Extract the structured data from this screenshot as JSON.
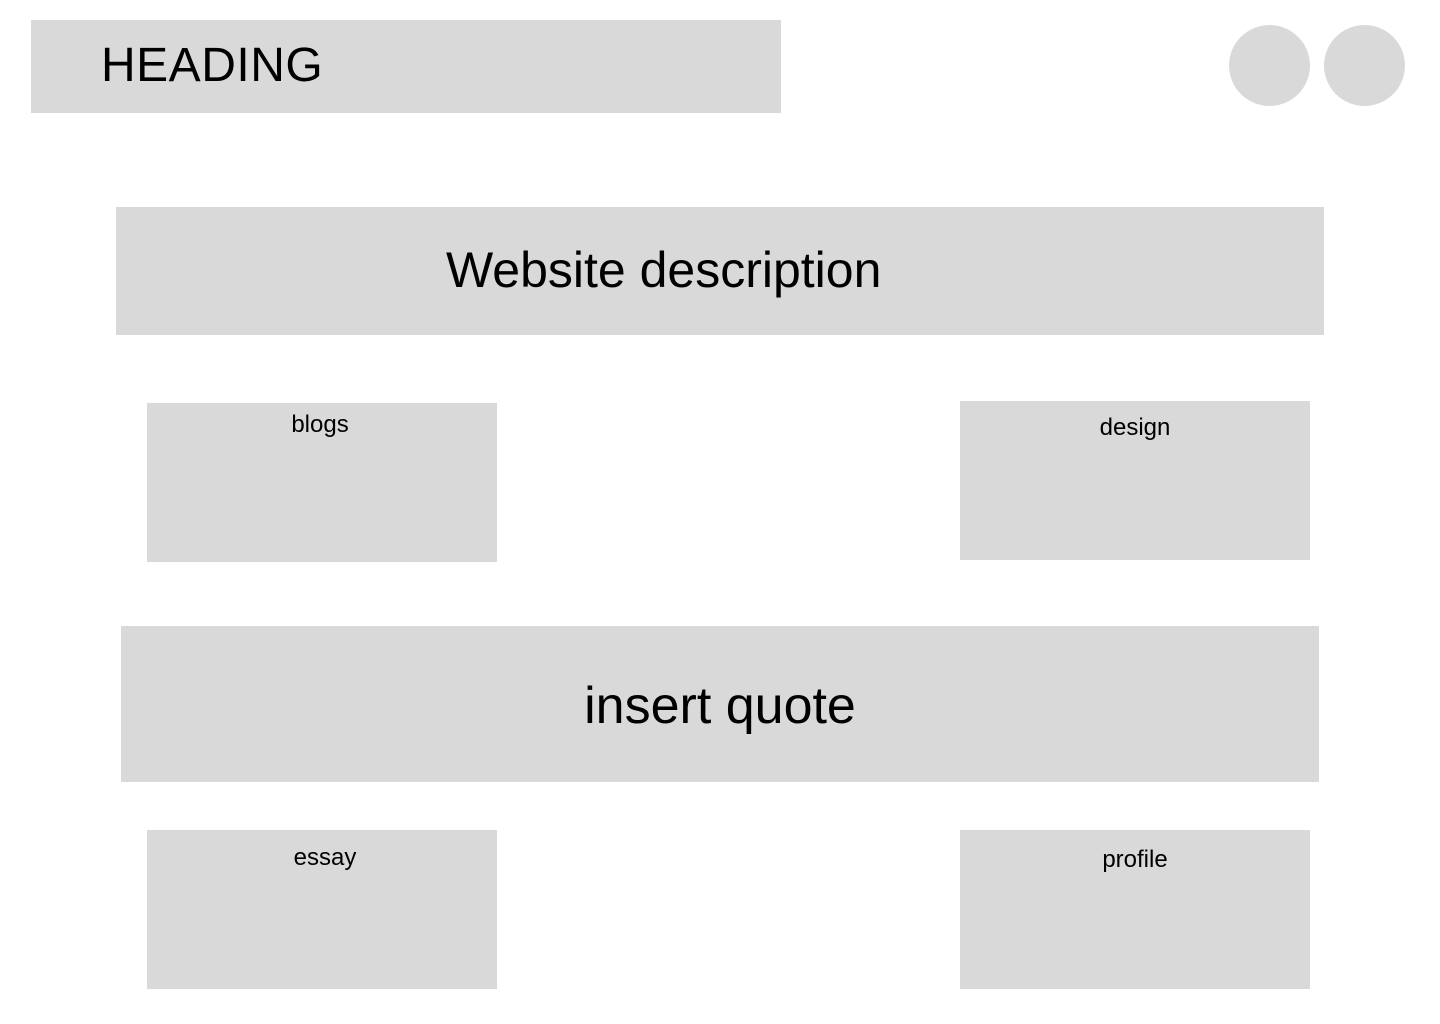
{
  "header": {
    "heading": "HEADING",
    "actions": [
      {
        "icon": "circle-placeholder-icon"
      },
      {
        "icon": "circle-placeholder-icon"
      }
    ]
  },
  "hero": {
    "description": "Website description"
  },
  "cards_top": {
    "left_label": "blogs",
    "right_label": "design"
  },
  "quote": {
    "text": "insert quote"
  },
  "cards_bottom": {
    "left_label": "essay",
    "right_label": "profile"
  },
  "colors": {
    "placeholder_fill": "#d9d9d9",
    "background": "#ffffff",
    "text": "#000000"
  }
}
